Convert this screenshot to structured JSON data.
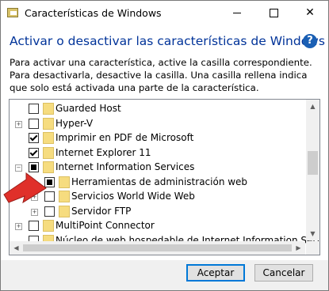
{
  "window": {
    "title": "Características de Windows",
    "controls": {
      "minimize": "—",
      "maximize": "☐",
      "close": "✕"
    }
  },
  "heading": "Activar o desactivar las características de Windows",
  "help_label": "?",
  "description": "Para activar una característica, active la casilla correspondiente. Para desactivarla, desactive la casilla. Una casilla rellena indica que solo está activada una parte de la característica.",
  "features": [
    {
      "label": "Guarded Host",
      "state": "unchecked",
      "expander": "none",
      "level": 0
    },
    {
      "label": "Hyper-V",
      "state": "unchecked",
      "expander": "plus",
      "level": 0
    },
    {
      "label": "Imprimir en PDF de Microsoft",
      "state": "checked",
      "expander": "none",
      "level": 0
    },
    {
      "label": "Internet Explorer 11",
      "state": "checked",
      "expander": "none",
      "level": 0
    },
    {
      "label": "Internet Information Services",
      "state": "partial",
      "expander": "minus",
      "level": 0
    },
    {
      "label": "Herramientas de administración web",
      "state": "partial",
      "expander": "none",
      "level": 1
    },
    {
      "label": "Servicios World Wide Web",
      "state": "unchecked",
      "expander": "plus",
      "level": 1
    },
    {
      "label": "Servidor FTP",
      "state": "unchecked",
      "expander": "plus",
      "level": 1
    },
    {
      "label": "MultiPoint Connector",
      "state": "unchecked",
      "expander": "plus",
      "level": 0
    },
    {
      "label": "Núcleo de web hospedable de Internet Information Services",
      "state": "unchecked",
      "expander": "none",
      "level": 0
    }
  ],
  "buttons": {
    "accept": "Aceptar",
    "cancel": "Cancelar"
  },
  "annotation": {
    "icon": "red-arrow-icon",
    "color": "#e0302a"
  }
}
